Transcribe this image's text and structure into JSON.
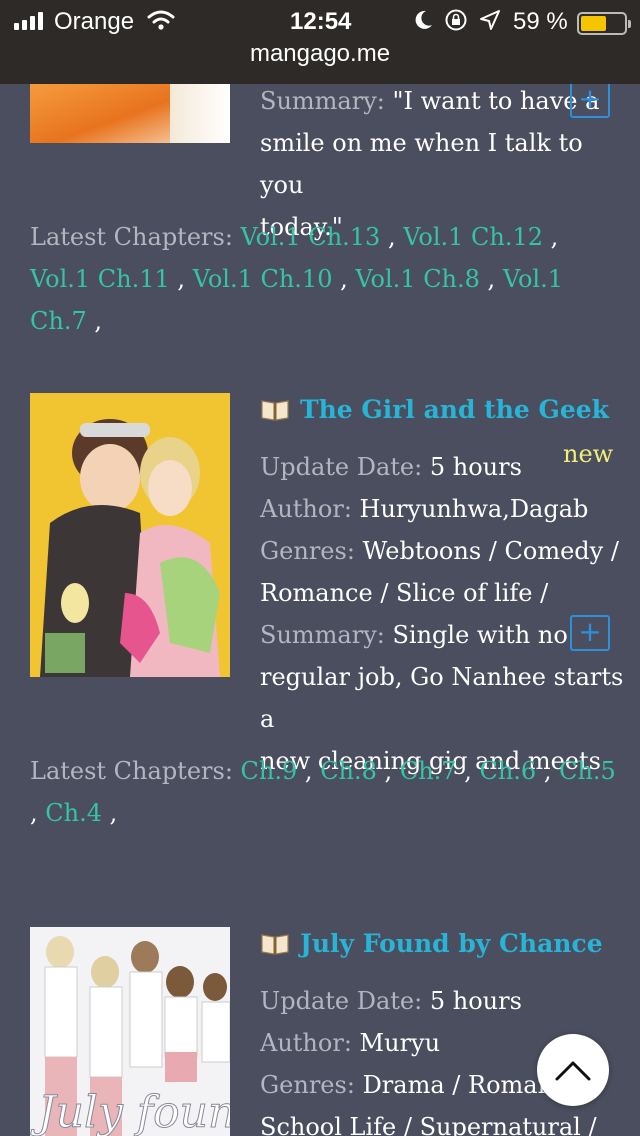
{
  "status_bar": {
    "carrier": "Orange",
    "time": "12:54",
    "battery_percent": "59 %",
    "battery_level": 0.59,
    "url": "mangago.me"
  },
  "items": [
    {
      "summary_label": "Summary:",
      "summary_lines": [
        "\"I want to have a",
        "smile on me when I talk to you",
        "today.\""
      ],
      "latest_label": "Latest Chapters:",
      "chapters": [
        "Vol.1 Ch.13",
        "Vol.1 Ch.12",
        "Vol.1 Ch.11",
        "Vol.1 Ch.10",
        "Vol.1 Ch.8",
        "Vol.1 Ch.7"
      ]
    },
    {
      "title": "The Girl and the Geek",
      "badge": "new",
      "update_label": "Update Date:",
      "update_value": "5 hours",
      "author_label": "Author:",
      "author_value": "Huryunhwa,Dagab",
      "genres_label": "Genres:",
      "genres_line1": "Webtoons / Comedy /",
      "genres_line2": "Romance / Slice of life /",
      "summary_label": "Summary:",
      "summary_line1": "Single with no",
      "summary_line2": "regular job, Go Nanhee starts a",
      "summary_line3": "new cleaning gig and meets",
      "latest_label": "Latest Chapters:",
      "chapters": [
        "Ch.9",
        "Ch.8",
        "Ch.7",
        "Ch.6",
        "Ch.5",
        "Ch.4"
      ]
    },
    {
      "title": "July Found by Chance",
      "update_label": "Update Date:",
      "update_value": "5 hours",
      "author_label": "Author:",
      "author_value": "Muryu",
      "genres_label": "Genres:",
      "genres_line1": "Drama / Romanc",
      "genres_line2": "School Life / Supernatural /",
      "cover_text": "July found by"
    }
  ],
  "controls": {
    "expand_symbol": "+",
    "separator": ","
  },
  "icons": {
    "book": "book-icon",
    "scroll_top": "chevron-up-icon"
  },
  "colors": {
    "background": "#4b4e5e",
    "title": "#27b4d6",
    "chapter_link": "#35c4a6",
    "label": "#b3b6c0",
    "new_badge": "#f1ee7a",
    "plus_button": "#2e8fdc"
  }
}
